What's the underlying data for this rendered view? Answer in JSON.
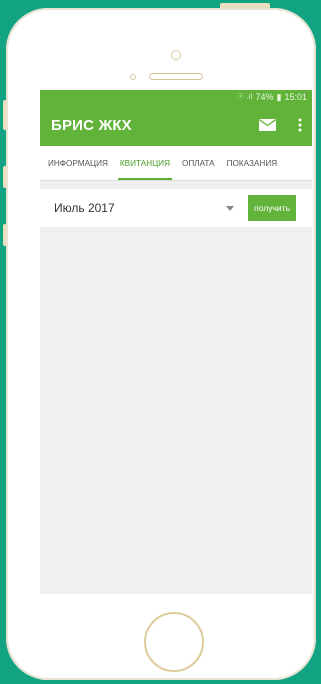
{
  "status_bar": {
    "signal": "☉ .ıl",
    "battery": "74%",
    "time": "15:01"
  },
  "app": {
    "title": "БРИС ЖКХ",
    "mail_icon": "mail-icon",
    "more_icon": "more-vertical-icon"
  },
  "tabs": [
    {
      "label": "ИНФОРМАЦИЯ",
      "active": false
    },
    {
      "label": "КВИТАНЦИЯ",
      "active": true
    },
    {
      "label": "ОПЛАТА",
      "active": false
    },
    {
      "label": "ПОКАЗАНИЯ",
      "active": false
    }
  ],
  "receipt": {
    "month_select": "Июль 2017",
    "get_button": "получить"
  },
  "colors": {
    "accent": "#62b33a",
    "background": "#12a383"
  }
}
